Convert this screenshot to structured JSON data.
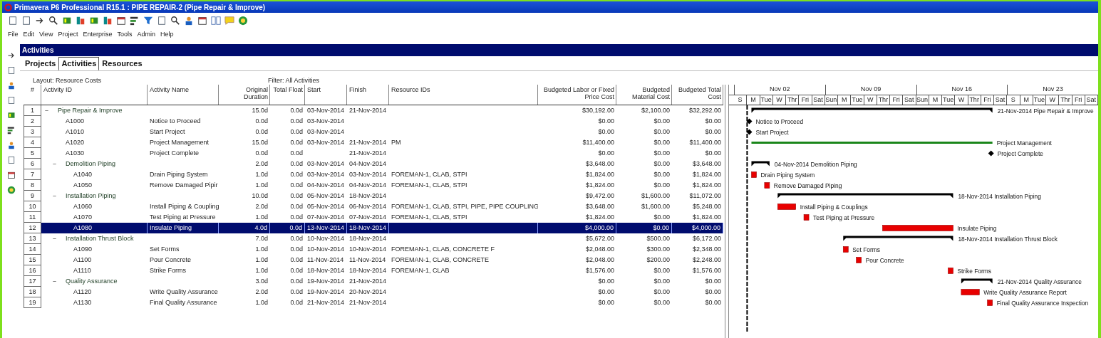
{
  "window": {
    "title": "Primavera P6 Professional R15.1 : PIPE REPAIR-2 (Pipe Repair & Improve)"
  },
  "menu": [
    "File",
    "Edit",
    "View",
    "Project",
    "Enterprise",
    "Tools",
    "Admin",
    "Help"
  ],
  "section_title": "Activities",
  "tabs": [
    {
      "label": "Projects",
      "selected": false
    },
    {
      "label": "Activities",
      "selected": true
    },
    {
      "label": "Resources",
      "selected": false
    }
  ],
  "layout_label": "Layout: Resource Costs",
  "filter_label": "Filter: All Activities",
  "columns": [
    {
      "label": "#",
      "kind": "center"
    },
    {
      "label": "Activity ID",
      "kind": "text"
    },
    {
      "label": "Activity Name",
      "kind": "text"
    },
    {
      "label": "Original Duration",
      "kind": "number"
    },
    {
      "label": "Total Float",
      "kind": "number"
    },
    {
      "label": "Start",
      "kind": "text"
    },
    {
      "label": "Finish",
      "kind": "text"
    },
    {
      "label": "Resource IDs",
      "kind": "text"
    },
    {
      "label": "Budgeted Labor or Fixed Price Cost",
      "kind": "number"
    },
    {
      "label": "Budgeted Material Cost",
      "kind": "number"
    },
    {
      "label": "Budgeted Total Cost",
      "kind": "number"
    }
  ],
  "timescale": {
    "weeks": [
      "Nov 02",
      "Nov 09",
      "Nov 16",
      "Nov 23"
    ],
    "days": [
      "S",
      "M",
      "Tue",
      "W",
      "Thr",
      "Fri",
      "Sat",
      "Sun",
      "M",
      "Tue",
      "W",
      "Thr",
      "Fri",
      "Sat",
      "Sun",
      "M",
      "Tue",
      "W",
      "Thr",
      "Fri",
      "Sat",
      "S",
      "M",
      "Tue",
      "W",
      "Thr",
      "Fri",
      "Sat"
    ]
  },
  "activities": [
    {
      "num": "1",
      "kind": "wbs",
      "name": "Pipe Repair & Improve",
      "expanded": true,
      "selected": false,
      "original_duration": "15.0d",
      "total_float": "0.0d",
      "start": "03-Nov-2014",
      "finish": "21-Nov-2014",
      "labor_cost": "$30,192.00",
      "material_cost": "$2,100.00",
      "total_cost": "$32,292.00",
      "bar": {
        "kind": "summary",
        "label": "21-Nov-2014  Pipe Repair & Improve"
      },
      "children": [
        {
          "num": "2",
          "kind": "activity",
          "activity_id": "A1000",
          "activity_name": "Notice to Proceed",
          "selected": false,
          "original_duration": "0.0d",
          "total_float": "0.0d",
          "start": "03-Nov-2014",
          "labor_cost": "$0.00",
          "material_cost": "$0.00",
          "total_cost": "$0.00",
          "bar": {
            "kind": "milestone",
            "label": "Notice to Proceed"
          }
        },
        {
          "num": "3",
          "kind": "activity",
          "activity_id": "A1010",
          "activity_name": "Start Project",
          "selected": false,
          "original_duration": "0.0d",
          "total_float": "0.0d",
          "start": "03-Nov-2014",
          "labor_cost": "$0.00",
          "material_cost": "$0.00",
          "total_cost": "$0.00",
          "bar": {
            "kind": "milestone",
            "label": "Start Project"
          }
        },
        {
          "num": "4",
          "kind": "activity",
          "activity_id": "A1020",
          "activity_name": "Project Management",
          "selected": false,
          "original_duration": "15.0d",
          "total_float": "0.0d",
          "start": "03-Nov-2014",
          "finish": "21-Nov-2014",
          "resource_ids": "PM",
          "labor_cost": "$11,400.00",
          "material_cost": "$0.00",
          "total_cost": "$11,400.00",
          "bar": {
            "kind": "level_of_effort",
            "label": "Project Management"
          }
        },
        {
          "num": "5",
          "kind": "activity",
          "activity_id": "A1030",
          "activity_name": "Project Complete",
          "selected": false,
          "original_duration": "0.0d",
          "total_float": "0.0d",
          "finish": "21-Nov-2014",
          "labor_cost": "$0.00",
          "material_cost": "$0.00",
          "total_cost": "$0.00",
          "bar": {
            "kind": "milestone",
            "label": "Project Complete"
          }
        },
        {
          "num": "6",
          "kind": "wbs",
          "name": "Demolition Piping",
          "expanded": true,
          "selected": false,
          "original_duration": "2.0d",
          "total_float": "0.0d",
          "start": "03-Nov-2014",
          "finish": "04-Nov-2014",
          "labor_cost": "$3,648.00",
          "material_cost": "$0.00",
          "total_cost": "$3,648.00",
          "bar": {
            "kind": "summary",
            "label": "04-Nov-2014  Demolition Piping"
          },
          "children": [
            {
              "num": "7",
              "kind": "activity",
              "activity_id": "A1040",
              "activity_name": "Drain Piping System",
              "selected": false,
              "original_duration": "1.0d",
              "total_float": "0.0d",
              "start": "03-Nov-2014",
              "finish": "03-Nov-2014",
              "resource_ids": "FOREMAN-1, CLAB, STPI",
              "labor_cost": "$1,824.00",
              "material_cost": "$0.00",
              "total_cost": "$1,824.00",
              "bar": {
                "kind": "task",
                "label": "Drain Piping System"
              }
            },
            {
              "num": "8",
              "kind": "activity",
              "activity_id": "A1050",
              "activity_name": "Remove Damaged Pipir",
              "selected": false,
              "original_duration": "1.0d",
              "total_float": "0.0d",
              "start": "04-Nov-2014",
              "finish": "04-Nov-2014",
              "resource_ids": "FOREMAN-1, CLAB, STPI",
              "labor_cost": "$1,824.00",
              "material_cost": "$0.00",
              "total_cost": "$1,824.00",
              "bar": {
                "kind": "task",
                "label": "Remove Damaged Piping"
              }
            }
          ]
        },
        {
          "num": "9",
          "kind": "wbs",
          "name": "Installation Piping",
          "expanded": true,
          "selected": false,
          "original_duration": "10.0d",
          "total_float": "0.0d",
          "start": "05-Nov-2014",
          "finish": "18-Nov-2014",
          "labor_cost": "$9,472.00",
          "material_cost": "$1,600.00",
          "total_cost": "$11,072.00",
          "bar": {
            "kind": "summary",
            "label": "18-Nov-2014  Installation Piping"
          },
          "children": [
            {
              "num": "10",
              "kind": "activity",
              "activity_id": "A1060",
              "activity_name": "Install Piping & Coupling",
              "selected": false,
              "original_duration": "2.0d",
              "total_float": "0.0d",
              "start": "05-Nov-2014",
              "finish": "06-Nov-2014",
              "resource_ids": "FOREMAN-1, CLAB, STPI, PIPE, PIPE COUPLING",
              "labor_cost": "$3,648.00",
              "material_cost": "$1,600.00",
              "total_cost": "$5,248.00",
              "bar": {
                "kind": "task",
                "label": "Install Piping & Couplings"
              }
            },
            {
              "num": "11",
              "kind": "activity",
              "activity_id": "A1070",
              "activity_name": "Test Piping at Pressure",
              "selected": false,
              "original_duration": "1.0d",
              "total_float": "0.0d",
              "start": "07-Nov-2014",
              "finish": "07-Nov-2014",
              "resource_ids": "FOREMAN-1, CLAB, STPI",
              "labor_cost": "$1,824.00",
              "material_cost": "$0.00",
              "total_cost": "$1,824.00",
              "bar": {
                "kind": "task",
                "label": "Test Piping at Pressure"
              }
            },
            {
              "num": "12",
              "kind": "activity",
              "activity_id": "A1080",
              "activity_name": "Insulate Piping",
              "selected": true,
              "original_duration": "4.0d",
              "total_float": "0.0d",
              "start": "13-Nov-2014",
              "finish": "18-Nov-2014",
              "labor_cost": "$4,000.00",
              "material_cost": "$0.00",
              "total_cost": "$4,000.00",
              "bar": {
                "kind": "task",
                "label": "Insulate Piping"
              }
            }
          ]
        },
        {
          "num": "13",
          "kind": "wbs",
          "name": "Installation Thrust Block",
          "expanded": true,
          "selected": false,
          "original_duration": "7.0d",
          "total_float": "0.0d",
          "start": "10-Nov-2014",
          "finish": "18-Nov-2014",
          "labor_cost": "$5,672.00",
          "material_cost": "$500.00",
          "total_cost": "$6,172.00",
          "bar": {
            "kind": "summary",
            "label": "18-Nov-2014  Installation Thrust Block"
          },
          "children": [
            {
              "num": "14",
              "kind": "activity",
              "activity_id": "A1090",
              "activity_name": "Set Forms",
              "selected": false,
              "original_duration": "1.0d",
              "total_float": "0.0d",
              "start": "10-Nov-2014",
              "finish": "10-Nov-2014",
              "resource_ids": "FOREMAN-1, CLAB, CONCRETE F",
              "labor_cost": "$2,048.00",
              "material_cost": "$300.00",
              "total_cost": "$2,348.00",
              "bar": {
                "kind": "task",
                "label": "Set Forms"
              }
            },
            {
              "num": "15",
              "kind": "activity",
              "activity_id": "A1100",
              "activity_name": "Pour Concrete",
              "selected": false,
              "original_duration": "1.0d",
              "total_float": "0.0d",
              "start": "11-Nov-2014",
              "finish": "11-Nov-2014",
              "resource_ids": "FOREMAN-1, CLAB, CONCRETE",
              "labor_cost": "$2,048.00",
              "material_cost": "$200.00",
              "total_cost": "$2,248.00",
              "bar": {
                "kind": "task",
                "label": "Pour Concrete"
              }
            },
            {
              "num": "16",
              "kind": "activity",
              "activity_id": "A1110",
              "activity_name": "Strike Forms",
              "selected": false,
              "original_duration": "1.0d",
              "total_float": "0.0d",
              "start": "18-Nov-2014",
              "finish": "18-Nov-2014",
              "resource_ids": "FOREMAN-1, CLAB",
              "labor_cost": "$1,576.00",
              "material_cost": "$0.00",
              "total_cost": "$1,576.00",
              "bar": {
                "kind": "task",
                "label": "Strike Forms"
              }
            }
          ]
        },
        {
          "num": "17",
          "kind": "wbs",
          "name": "Quality Assurance",
          "expanded": true,
          "selected": false,
          "original_duration": "3.0d",
          "total_float": "0.0d",
          "start": "19-Nov-2014",
          "finish": "21-Nov-2014",
          "labor_cost": "$0.00",
          "material_cost": "$0.00",
          "total_cost": "$0.00",
          "bar": {
            "kind": "summary",
            "label": "21-Nov-2014  Quality Assurance"
          },
          "children": [
            {
              "num": "18",
              "kind": "activity",
              "activity_id": "A1120",
              "activity_name": "Write Quality Assurance",
              "selected": false,
              "original_duration": "2.0d",
              "total_float": "0.0d",
              "start": "19-Nov-2014",
              "finish": "20-Nov-2014",
              "labor_cost": "$0.00",
              "material_cost": "$0.00",
              "total_cost": "$0.00",
              "bar": {
                "kind": "task",
                "label": "Write Quality Assurance Report"
              }
            },
            {
              "num": "19",
              "kind": "activity",
              "activity_id": "A1130",
              "activity_name": "Final Quality Assurance",
              "selected": false,
              "original_duration": "1.0d",
              "total_float": "0.0d",
              "start": "21-Nov-2014",
              "finish": "21-Nov-2014",
              "labor_cost": "$0.00",
              "material_cost": "$0.00",
              "total_cost": "$0.00",
              "bar": {
                "kind": "task",
                "label": "Final Quality Assurance Inspection"
              }
            }
          ]
        }
      ]
    }
  ]
}
